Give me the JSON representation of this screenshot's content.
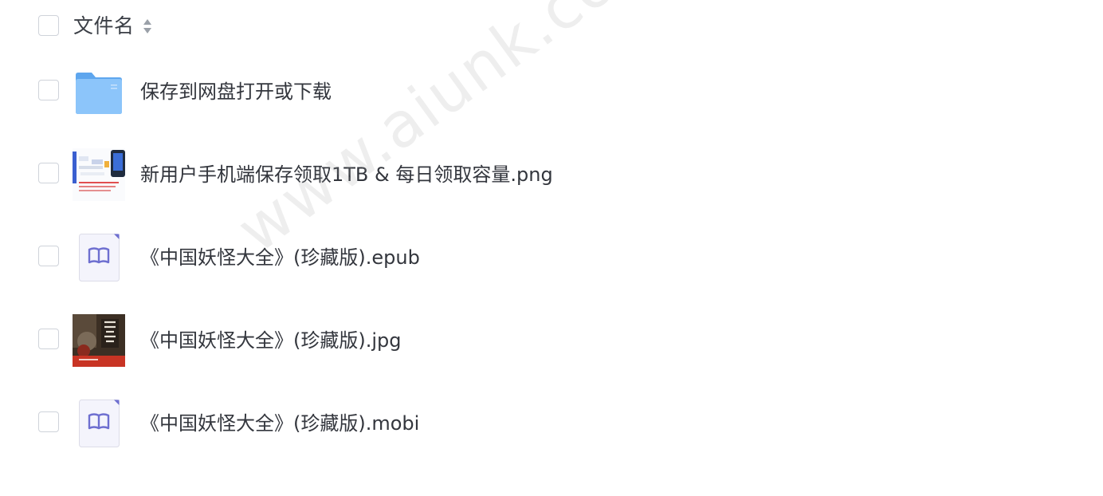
{
  "header": {
    "select_all": false,
    "column_label": "文件名"
  },
  "files": [
    {
      "name": "保存到网盘打开或下载",
      "type": "folder",
      "thumb_icon": "folder-icon"
    },
    {
      "name": "新用户手机端保存领取1TB & 每日领取容量.png",
      "type": "image",
      "thumb_icon": "screenshot-thumbnail"
    },
    {
      "name": "《中国妖怪大全》(珍藏版).epub",
      "type": "ebook",
      "thumb_icon": "book-icon"
    },
    {
      "name": "《中国妖怪大全》(珍藏版).jpg",
      "type": "image",
      "thumb_icon": "cover-thumbnail"
    },
    {
      "name": "《中国妖怪大全》(珍藏版).mobi",
      "type": "ebook",
      "thumb_icon": "book-icon"
    }
  ],
  "watermark": "www.aiunk.com",
  "colors": {
    "folder": "#7ab8f5",
    "ebook_accent": "#6e6fd0",
    "checkbox_border": "#cfd3da"
  }
}
